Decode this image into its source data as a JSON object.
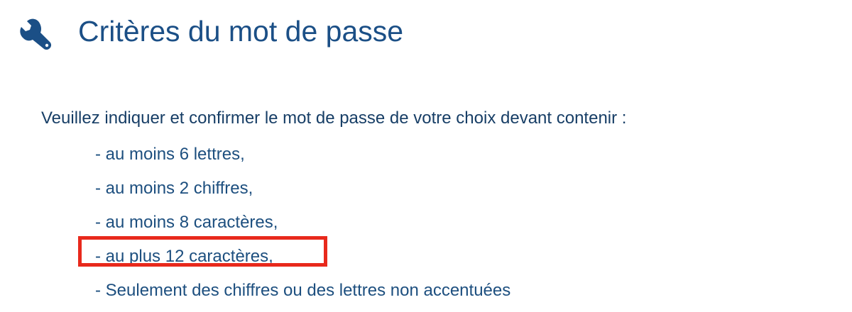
{
  "header": {
    "icon": "wrench-icon",
    "title": "Critères du mot de passe"
  },
  "instructions": {
    "intro": "Veuillez indiquer et confirmer le mot de passe de votre choix devant contenir :",
    "criteria": [
      "- au moins 6 lettres,",
      "- au moins 2 chiffres,",
      "- au moins 8 caractères,",
      "- au plus 12 caractères,",
      "- Seulement des chiffres ou des lettres non accentuées"
    ]
  },
  "colors": {
    "title": "#1b4f86",
    "text": "#1d4f7f",
    "highlight": "#e8291c"
  }
}
